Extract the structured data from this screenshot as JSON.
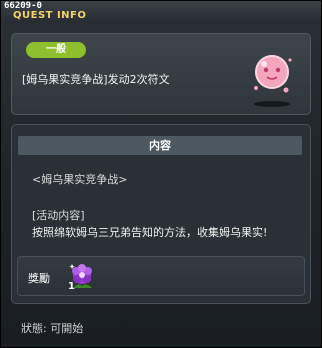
{
  "window": {
    "quest_id": "66209-0",
    "title": "QUEST INFO"
  },
  "quest": {
    "category_tag": "一般",
    "name": "[姆乌果实竞争战]发动2次符文",
    "mascot_icon": "pink-slime-icon"
  },
  "content": {
    "header": "内容",
    "subtitle": "<姆乌果实竞争战>",
    "activity_label": "[活动内容]",
    "activity_text": "按照绵软姆乌三兄弟告知的方法，收集姆乌果实!",
    "reward": {
      "label": "獎勵",
      "item_icon": "purple-flower-item-icon",
      "count": "1"
    }
  },
  "status": {
    "text": "狀態: 可開始"
  },
  "colors": {
    "title": "#f4d36a",
    "tag": "#8ebf2d",
    "header_bg": "#4d5860"
  }
}
